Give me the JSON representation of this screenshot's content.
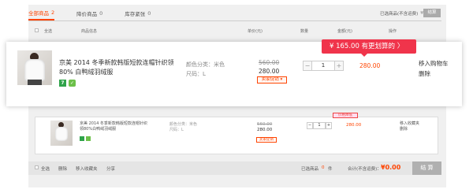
{
  "tabs": [
    {
      "label": "全部商品",
      "count": "2"
    },
    {
      "label": "降价商品",
      "count": "0"
    },
    {
      "label": "库存紧张",
      "count": "0"
    }
  ],
  "summary": {
    "label": "已选商品(不含运费)",
    "amount": "¥0.00",
    "button": "结算"
  },
  "header": {
    "select_all": "全选",
    "product": "商品信息",
    "unit_price": "单价(元)",
    "quantity": "数量",
    "subtotal": "金额(元)",
    "ops": "操作"
  },
  "item": {
    "title": "京美 2014 冬季新款韩版短款连帽针织领80% 白鸭绒羽绒服",
    "sku_color": "颜色分类：米色",
    "sku_size": "尺码：L",
    "original_price": "560.00",
    "price": "280.00",
    "promo": "卖家促销",
    "quantity": "1",
    "subtotal": "280.00",
    "tooltip": "¥ 165.00  有更划算的  〉",
    "add_to_fav": "移入购物车",
    "delete": "删除",
    "badge_7": "7"
  },
  "item2": {
    "title": "京美 2014 冬季新款韩版短款连帽针织领80%白鸭绒羽绒服",
    "sku_color": "颜色分类：米色",
    "sku_size": "尺码：L",
    "original_price": "560.00",
    "price": "280.00",
    "promo": "卖家促销",
    "quantity": "1",
    "flag": "价格降低",
    "subtotal": "280.00",
    "add_to_fav": "移入收藏夹",
    "delete": "删除"
  },
  "footer": {
    "select_all": "全选",
    "delete": "删除",
    "move_fav": "移入收藏夹",
    "share": "分享",
    "selected_label": "已选商品",
    "selected_count": "0",
    "selected_unit": "件",
    "total_label": "合计(不含运费)：",
    "total": "¥0.00",
    "settle": "结 算"
  },
  "colors": {
    "accent": "#ff4400",
    "tooltip": "#f0344b",
    "badge_green": "#2fa34a"
  }
}
